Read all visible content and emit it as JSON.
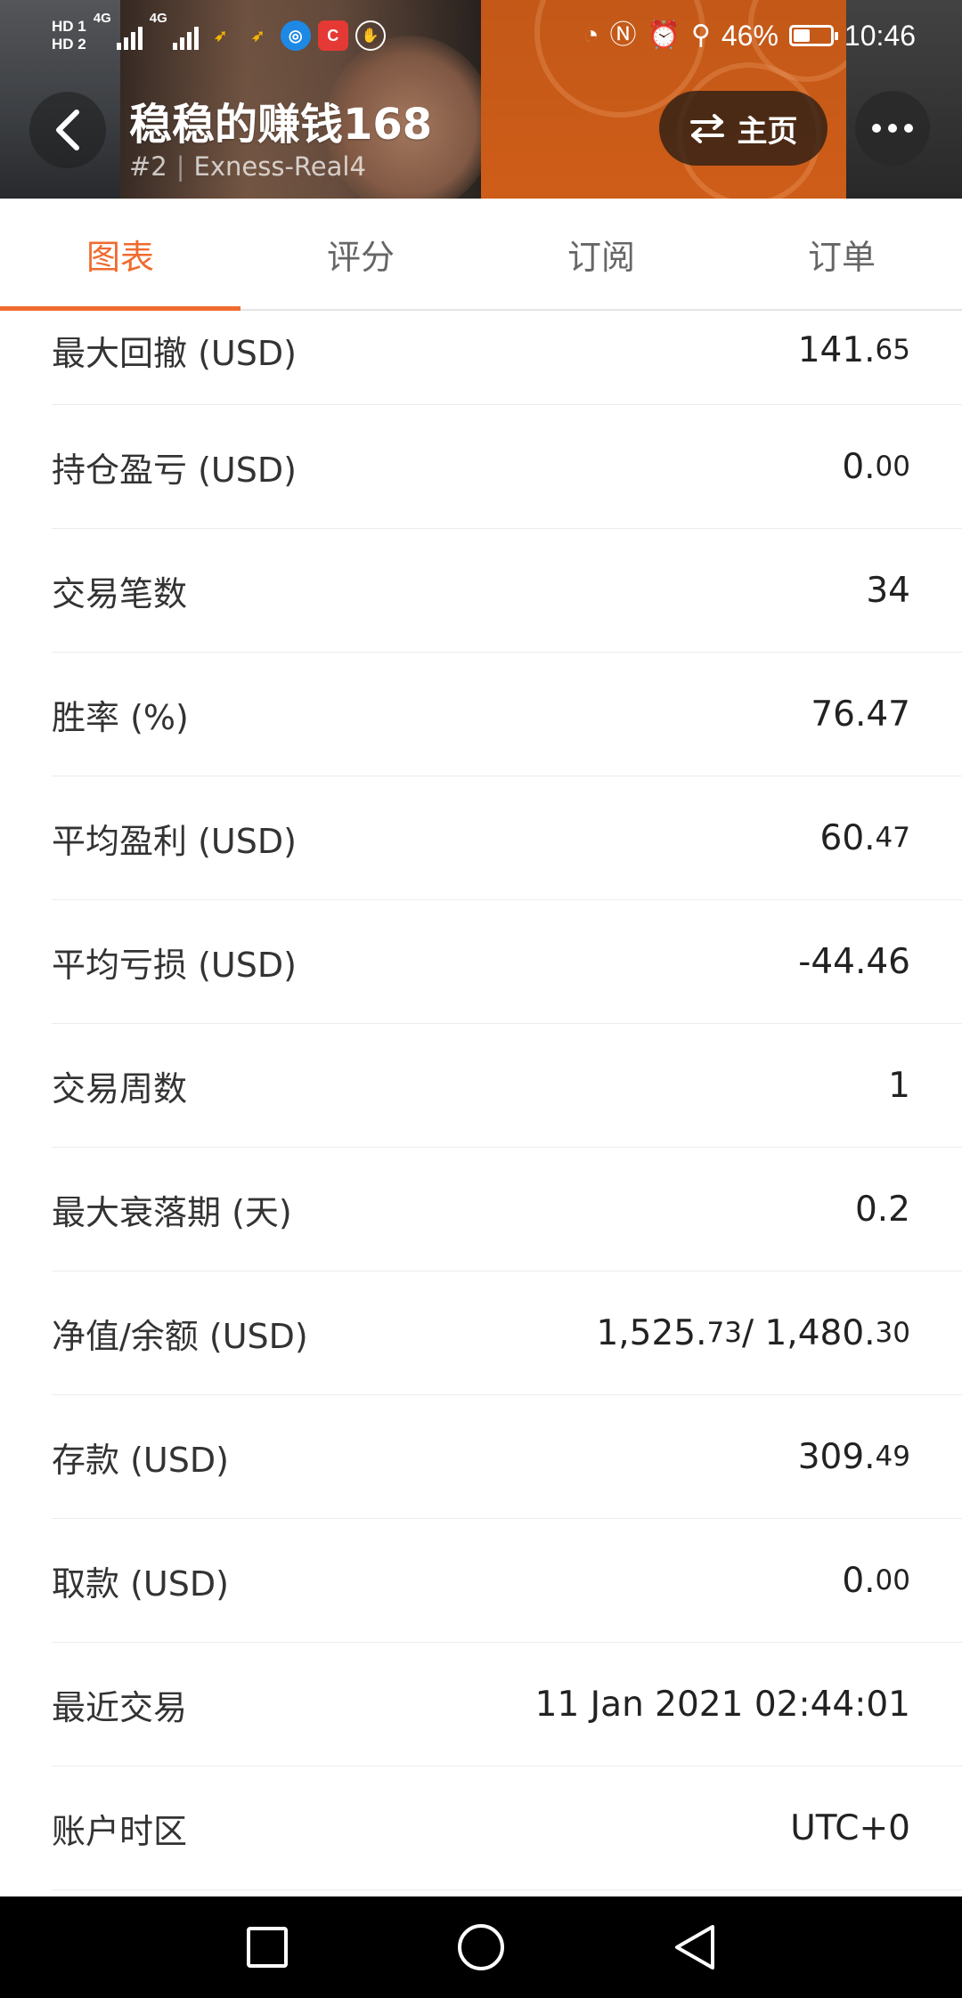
{
  "status_bar": {
    "hd_top": "HD 1",
    "hd_bottom": "HD 2",
    "net1": "4G",
    "net2": "4G",
    "battery_percent": "46%",
    "battery_level": 0.46,
    "time": "10:46",
    "icons": [
      "nfc-icon",
      "alarm-icon",
      "location-icon"
    ]
  },
  "header": {
    "title": "稳稳的赚钱168",
    "rank": "#2",
    "separator": "|",
    "server": "Exness-Real4",
    "home_label": "主页"
  },
  "tabs": [
    {
      "label": "图表",
      "active": true
    },
    {
      "label": "评分",
      "active": false
    },
    {
      "label": "订阅",
      "active": false
    },
    {
      "label": "订单",
      "active": false
    }
  ],
  "stats": [
    {
      "label": "最大回撤 (USD)",
      "main": "141.",
      "small": "65"
    },
    {
      "label": "持仓盈亏 (USD)",
      "main": "0.",
      "small": "00"
    },
    {
      "label": "交易笔数",
      "main": "34",
      "small": ""
    },
    {
      "label": "胜率 (%)",
      "main": "76.47",
      "small": ""
    },
    {
      "label": "平均盈利 (USD)",
      "main": "60.",
      "small": "47"
    },
    {
      "label": "平均亏损 (USD)",
      "main": "-44.46",
      "small": ""
    },
    {
      "label": "交易周数",
      "main": "1",
      "small": ""
    },
    {
      "label": "最大衰落期 (天)",
      "main": "0.2",
      "small": ""
    },
    {
      "label": "净值/余额 (USD)",
      "main": "1,525.",
      "small": "73",
      "main2": " / 1,480.",
      "small2": "30"
    },
    {
      "label": "存款 (USD)",
      "main": "309.",
      "small": "49"
    },
    {
      "label": "取款 (USD)",
      "main": "0.",
      "small": "00"
    },
    {
      "label": "最近交易",
      "main": "11 Jan 2021 02:44:01",
      "small": ""
    },
    {
      "label": "账户时区",
      "main": "UTC+0",
      "small": ""
    }
  ],
  "colors": {
    "accent": "#ef6b2f",
    "header_orange": "#d9621a",
    "text": "#222222",
    "divider": "#ececec"
  }
}
